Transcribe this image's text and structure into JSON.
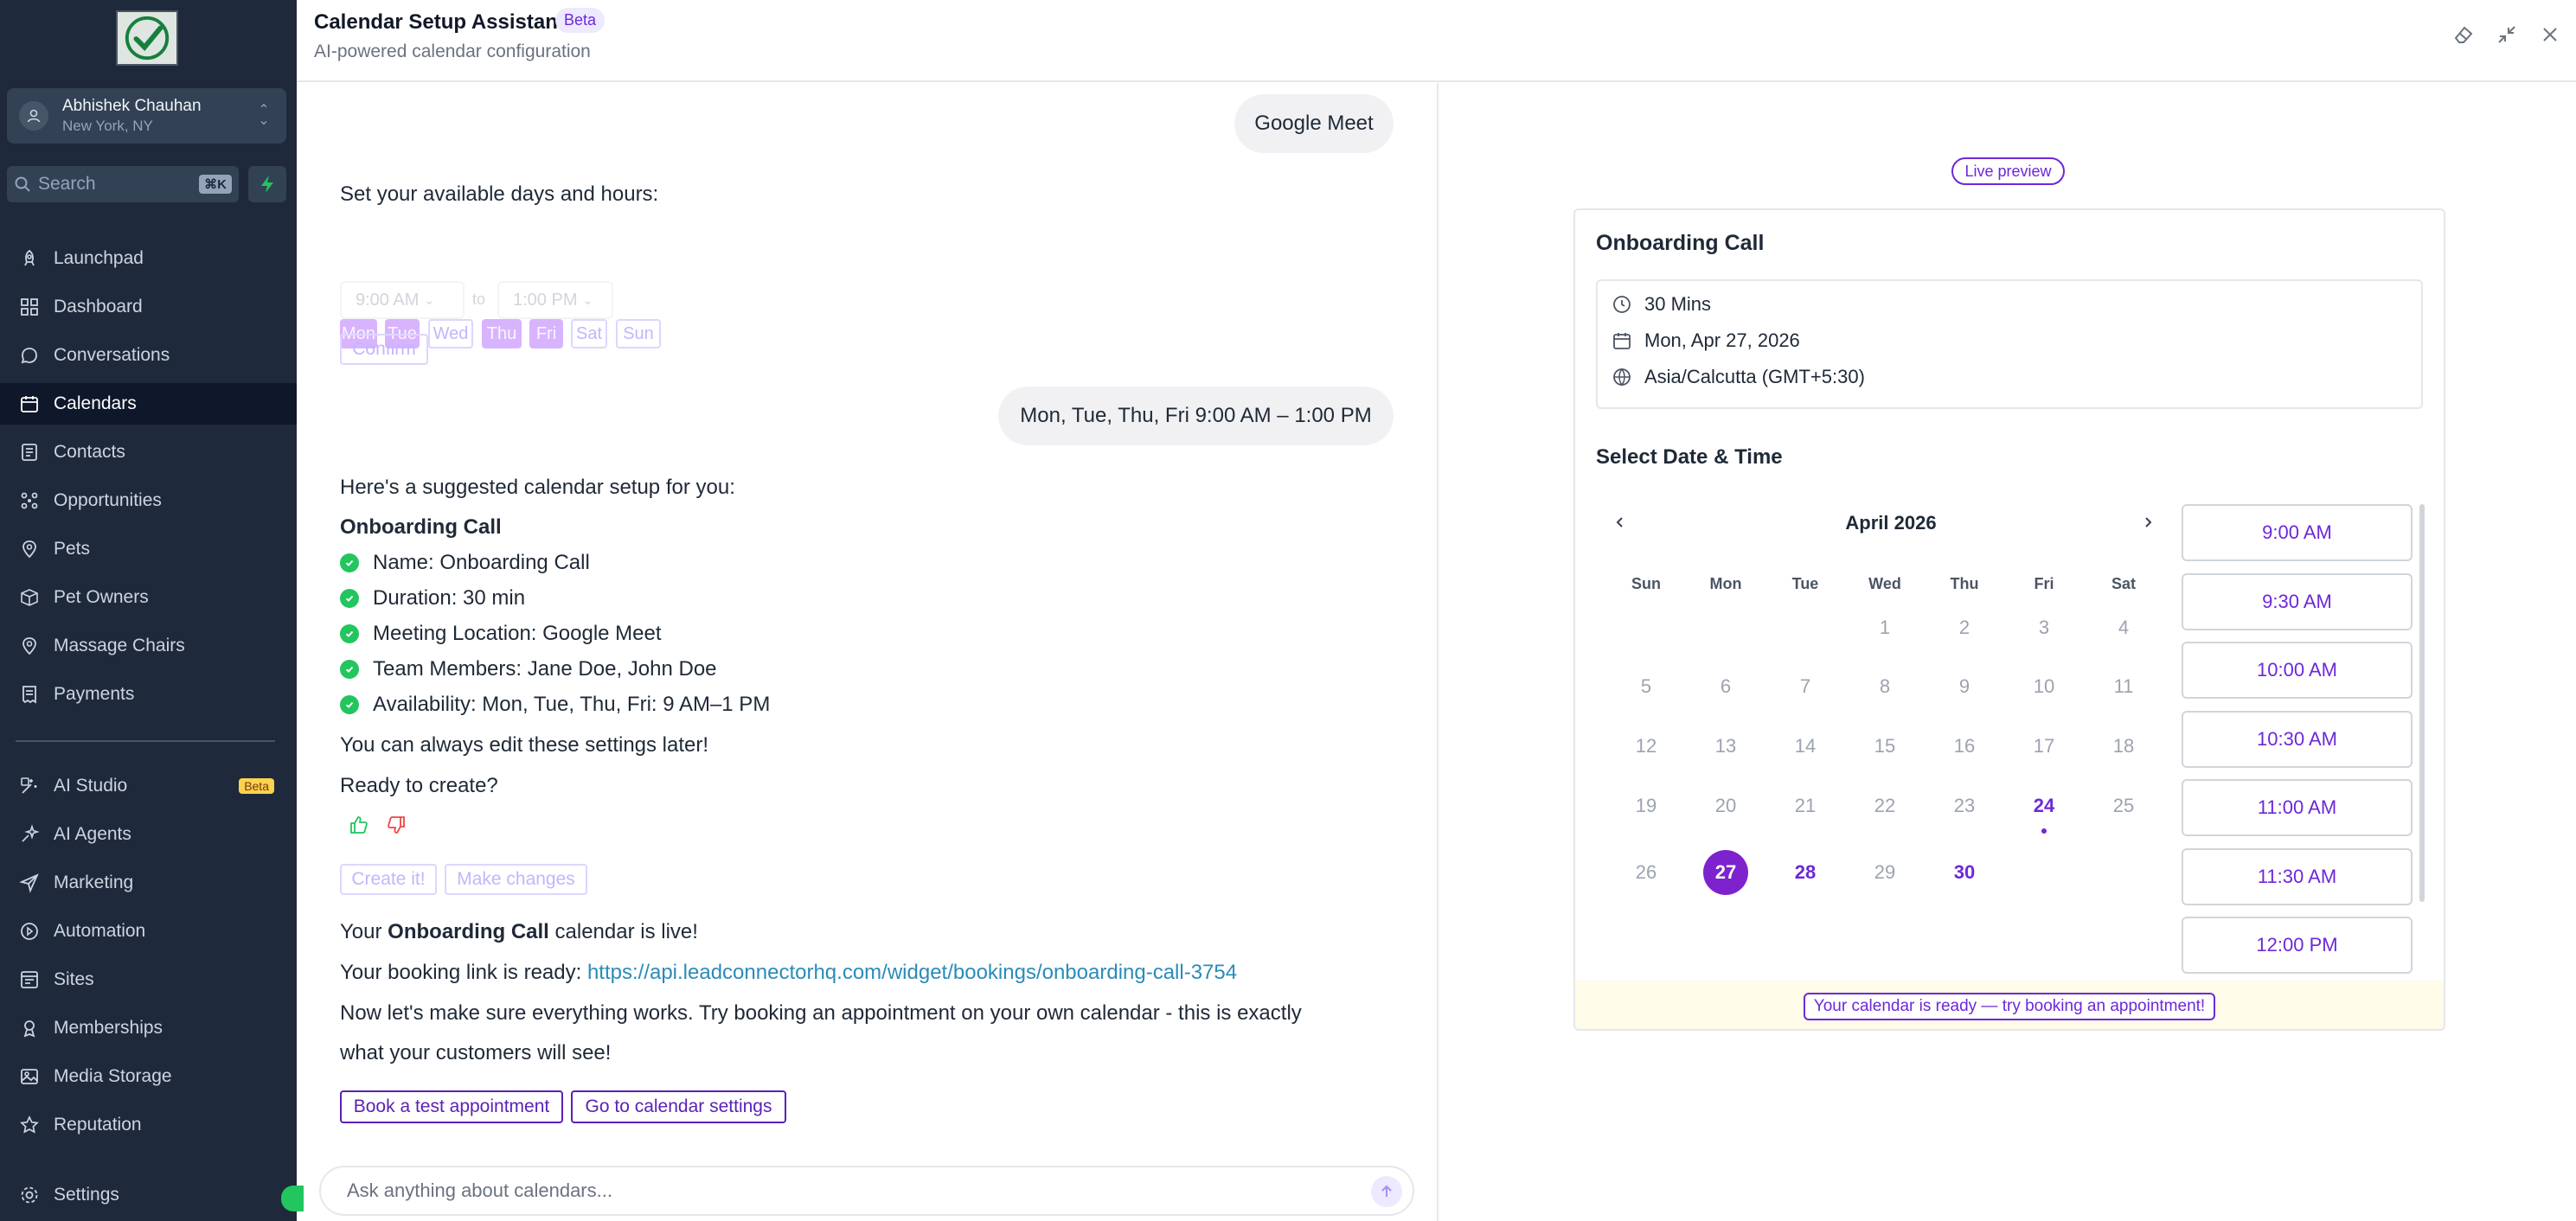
{
  "sidebar": {
    "account": {
      "name": "Abhishek Chauhan",
      "location": "New York, NY"
    },
    "search": {
      "placeholder": "Search",
      "shortcut": "⌘K"
    },
    "items": [
      {
        "label": "Launchpad",
        "icon": "rocket-icon"
      },
      {
        "label": "Dashboard",
        "icon": "grid-icon"
      },
      {
        "label": "Conversations",
        "icon": "chat-icon"
      },
      {
        "label": "Calendars",
        "icon": "calendar-icon",
        "active": true
      },
      {
        "label": "Contacts",
        "icon": "contacts-icon"
      },
      {
        "label": "Opportunities",
        "icon": "opportunities-icon"
      },
      {
        "label": "Pets",
        "icon": "pin-icon"
      },
      {
        "label": "Pet Owners",
        "icon": "box-icon"
      },
      {
        "label": "Massage Chairs",
        "icon": "pin-icon"
      },
      {
        "label": "Payments",
        "icon": "receipt-icon"
      }
    ],
    "items2": [
      {
        "label": "AI Studio",
        "icon": "ai-studio-icon",
        "badge": "Beta"
      },
      {
        "label": "AI Agents",
        "icon": "sparkle-icon"
      },
      {
        "label": "Marketing",
        "icon": "send-icon"
      },
      {
        "label": "Automation",
        "icon": "automation-icon"
      },
      {
        "label": "Sites",
        "icon": "sites-icon"
      },
      {
        "label": "Memberships",
        "icon": "membership-icon"
      },
      {
        "label": "Media Storage",
        "icon": "image-icon"
      },
      {
        "label": "Reputation",
        "icon": "star-icon"
      }
    ],
    "settings": {
      "label": "Settings",
      "icon": "gear-icon"
    }
  },
  "header": {
    "title": "Calendar Setup Assistant",
    "badge": "Beta",
    "subtitle": "AI-powered calendar configuration"
  },
  "chat": {
    "bubble1": "Google Meet",
    "availability_prompt": "Set your available days and hours:",
    "days": [
      {
        "label": "Mon",
        "selected": true
      },
      {
        "label": "Tue",
        "selected": true
      },
      {
        "label": "Wed",
        "selected": false
      },
      {
        "label": "Thu",
        "selected": true
      },
      {
        "label": "Fri",
        "selected": true
      },
      {
        "label": "Sat",
        "selected": false
      },
      {
        "label": "Sun",
        "selected": false
      }
    ],
    "start_time": "9:00 AM",
    "to_label": "to",
    "end_time": "1:00 PM",
    "confirm_label": "Confirm",
    "bubble2": "Mon, Tue, Thu, Fri 9:00 AM – 1:00 PM",
    "suggest_intro": "Here's a suggested calendar setup for you:",
    "suggest_title": "Onboarding Call",
    "suggest_items": [
      "Name: Onboarding Call",
      "Duration: 30 min",
      "Meeting Location: Google Meet",
      "Team Members: Jane Doe, John Doe",
      "Availability: Mon, Tue, Thu, Fri: 9 AM–1 PM"
    ],
    "edit_note": "You can always edit these settings later!",
    "ready_q": "Ready to create?",
    "create_label": "Create it!",
    "changes_label": "Make changes",
    "live_prefix": "Your ",
    "live_name": "Onboarding Call",
    "live_suffix": " calendar is live!",
    "link_prefix": "Your booking link is ready: ",
    "link_url": "https://api.leadconnectorhq.com/widget/bookings/onboarding-call-3754",
    "test_line1": "Now let's make sure everything works. Try booking an appointment on your own calendar - this is exactly",
    "test_line2": "what your customers will see!",
    "btn_book": "Book a test appointment",
    "btn_settings": "Go to calendar settings",
    "input_placeholder": "Ask anything about calendars..."
  },
  "preview": {
    "badge": "Live preview",
    "title": "Onboarding Call",
    "duration": "30 Mins",
    "date": "Mon, Apr 27, 2026",
    "timezone": "Asia/Calcutta (GMT+5:30)",
    "select_title": "Select Date & Time",
    "month": "April 2026",
    "weekdays": [
      "Sun",
      "Mon",
      "Tue",
      "Wed",
      "Thu",
      "Fri",
      "Sat"
    ],
    "first_weekday_index": 3,
    "days_in_month": 30,
    "available_days": [
      24,
      27,
      28,
      29,
      30
    ],
    "dimmed_available_days": [
      29
    ],
    "selected_day": 27,
    "dot_days": [
      24
    ],
    "slots": [
      "9:00 AM",
      "9:30 AM",
      "10:00 AM",
      "10:30 AM",
      "11:00 AM",
      "11:30 AM",
      "12:00 PM"
    ],
    "banner": "Your calendar is ready — try booking an appointment!"
  },
  "colors": {
    "accent": "#6d28d9",
    "sidebar_bg": "#1e293b",
    "success": "#22c55e"
  }
}
